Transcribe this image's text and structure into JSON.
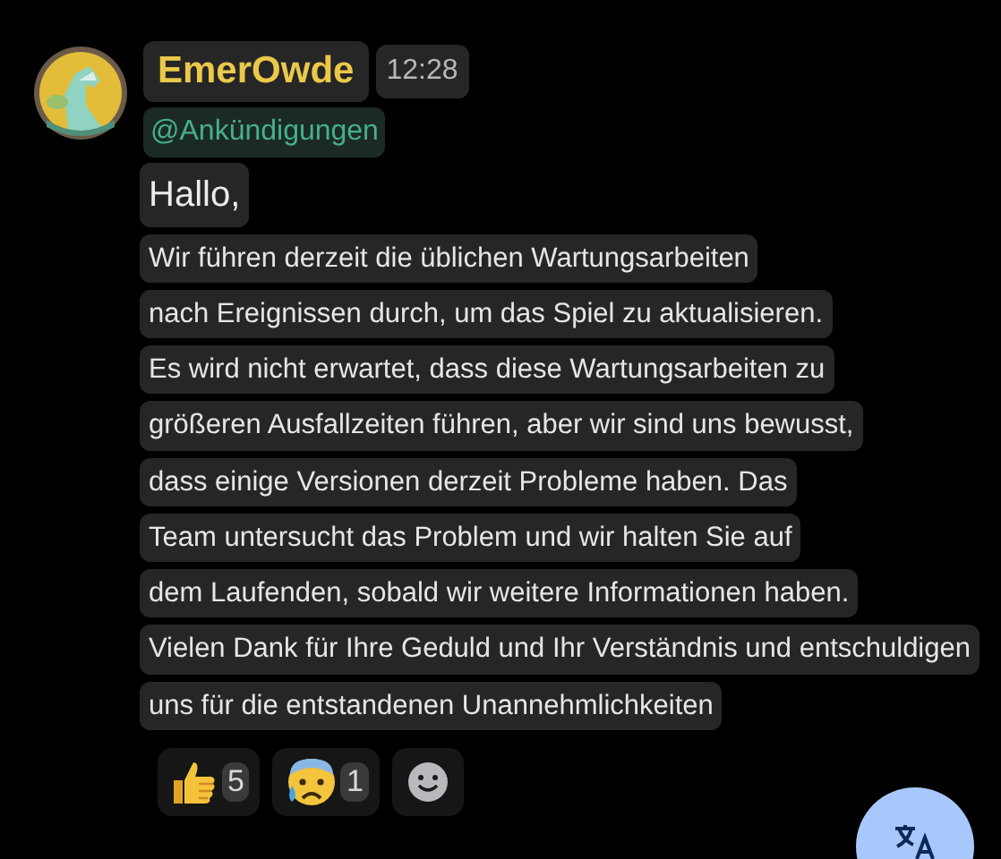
{
  "message": {
    "author": "EmerOwde",
    "time": "12:28",
    "mention": "@Ankündigungen",
    "lines": [
      "Hallo,",
      "Wir führen derzeit die üblichen Wartungsarbeiten",
      "nach Ereignissen durch, um das Spiel zu aktualisieren.",
      "Es wird nicht erwartet, dass diese Wartungsarbeiten zu",
      "größeren Ausfallzeiten führen, aber wir sind uns bewusst,",
      "dass einige Versionen derzeit Probleme haben. Das",
      "Team untersucht das Problem und wir halten Sie auf",
      "dem Laufenden, sobald wir weitere Informationen haben.",
      "Vielen Dank für Ihre Geduld und Ihr Verständnis und entschuldigen",
      "uns für die entstandenen Unannehmlichkeiten"
    ]
  },
  "reactions": [
    {
      "kind": "emoji",
      "count": "5"
    },
    {
      "kind": "emoji",
      "count": "1"
    },
    {
      "kind": "add"
    }
  ]
}
